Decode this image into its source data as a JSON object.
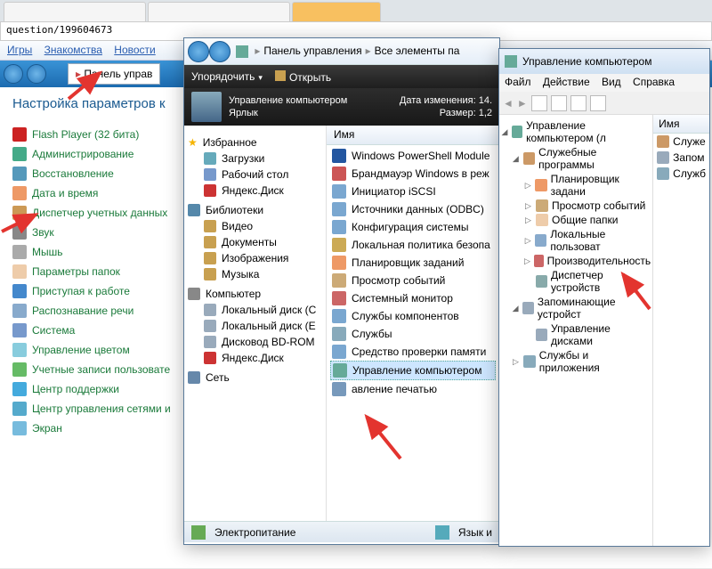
{
  "browser": {
    "tabs": [
      "…",
      "…",
      "…"
    ],
    "url": "question/199604673",
    "links": [
      "Игры",
      "Знакомства",
      "Новости"
    ]
  },
  "cp": {
    "crumb": "Панель управ",
    "title": "Настройка параметров к",
    "items": [
      "Flash Player (32 бита)",
      "Администрирование",
      "Восстановление",
      "Дата и время",
      "Диспетчер учетных данных",
      "Звук",
      "Мышь",
      "Параметры папок",
      "Приступая к работе",
      "Распознавание речи",
      "Система",
      "Управление цветом",
      "Учетные записи пользовате",
      "Центр поддержки",
      "Центр управления сетями и",
      "Экран"
    ]
  },
  "explorer": {
    "path1": "Панель управления",
    "path2": "Все элементы па",
    "toolbar": {
      "organize": "Упорядочить",
      "open": "Открыть"
    },
    "preview": {
      "title": "Управление компьютером",
      "type": "Ярлык",
      "date_label": "Дата изменения:",
      "date": "14.",
      "size_label": "Размер:",
      "size": "1,2"
    },
    "nav": {
      "fav": "Избранное",
      "fav_items": [
        "Загрузки",
        "Рабочий стол",
        "Яндекс.Диск"
      ],
      "lib": "Библиотеки",
      "lib_items": [
        "Видео",
        "Документы",
        "Изображения",
        "Музыка"
      ],
      "comp": "Компьютер",
      "comp_items": [
        "Локальный диск (C",
        "Локальный диск (E",
        "Дисковод BD-ROM",
        "Яндекс.Диск"
      ],
      "net": "Сеть"
    },
    "col_name": "Имя",
    "files": [
      "Windows PowerShell Module",
      "Брандмауэр Windows в реж",
      "Инициатор iSCSI",
      "Источники данных (ODBC)",
      "Конфигурация системы",
      "Локальная политика безопа",
      "Планировщик заданий",
      "Просмотр событий",
      "Системный монитор",
      "Службы компонентов",
      "Службы",
      "Средство проверки памяти",
      "Управление компьютером",
      "авление печатью"
    ],
    "status": {
      "a": "Электропитание",
      "b": "Язык и"
    }
  },
  "mmc": {
    "title": "Управление компьютером",
    "menu": [
      "Файл",
      "Действие",
      "Вид",
      "Справка"
    ],
    "root": "Управление компьютером (л",
    "sys": "Служебные программы",
    "sys_items": [
      "Планировщик задани",
      "Просмотр событий",
      "Общие папки",
      "Локальные пользоват",
      "Производительность",
      "Диспетчер устройств"
    ],
    "storage": "Запоминающие устройст",
    "storage_items": [
      "Управление дисками"
    ],
    "services": "Службы и приложения",
    "side_hd": "Имя",
    "side_items": [
      "Служе",
      "Запом",
      "Служб"
    ]
  }
}
